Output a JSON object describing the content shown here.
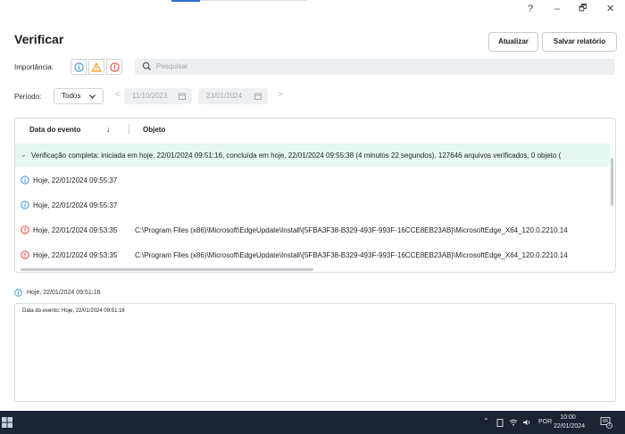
{
  "window": {
    "help": "?",
    "minimize": "–",
    "restore": "🗗",
    "close": "✕"
  },
  "header": {
    "title": "Verificar",
    "refresh_label": "Atualizar",
    "save_report_label": "Salvar relatório"
  },
  "filters": {
    "importance_label": "Importância:",
    "search_placeholder": "Pesquisar",
    "period_label": "Período:",
    "period_value": "Todos",
    "date_from": "11/10/2023",
    "date_to": "23/01/2024",
    "prev": "<",
    "next": ">"
  },
  "table": {
    "columns": [
      "Data do evento",
      "Objeto"
    ],
    "sort_arrow": "↓",
    "group_row": "Verificação completa: iniciada em hoje, 22/01/2024 09:51:16, concluída em hoje, 22/01/2024 09:55:38 (4 minutos 22 segundos), 127646 arquivos verificados, 0 objeto (",
    "rows": [
      {
        "severity": "info",
        "date": "Hoje, 22/01/2024 09:55:37",
        "object": ""
      },
      {
        "severity": "info",
        "date": "Hoje, 22/01/2024 09:55:37",
        "object": ""
      },
      {
        "severity": "error",
        "date": "Hoje, 22/01/2024 09:53:35",
        "object": "C:\\Program Files (x86)\\Microsoft\\EdgeUpdate\\Install\\{5FBA3F38-B329-493F-993F-16CCE8EB23AB}\\MicrosoftEdge_X64_120.0.2210.14"
      },
      {
        "severity": "error",
        "date": "Hoje, 22/01/2024 09:53:35",
        "object": "C:\\Program Files (x86)\\Microsoft\\EdgeUpdate\\Install\\{5FBA3F38-B329-493F-993F-16CCE8EB23AB}\\MicrosoftEdge_X64_120.0.2210.14"
      }
    ]
  },
  "detail": {
    "heading": "Hoje, 22/01/2024 09:51:16",
    "text": "Data do evento: Hoje, 22/01/2024 09:51:16"
  },
  "taskbar": {
    "language": "POR",
    "time": "10:00",
    "date": "22/01/2024",
    "notification_count": "1"
  },
  "colors": {
    "info": "#3b8fd8",
    "warning": "#f0a020",
    "error": "#e0453a",
    "group_bg": "#e7f6f1",
    "taskbar": "#1c2431"
  }
}
